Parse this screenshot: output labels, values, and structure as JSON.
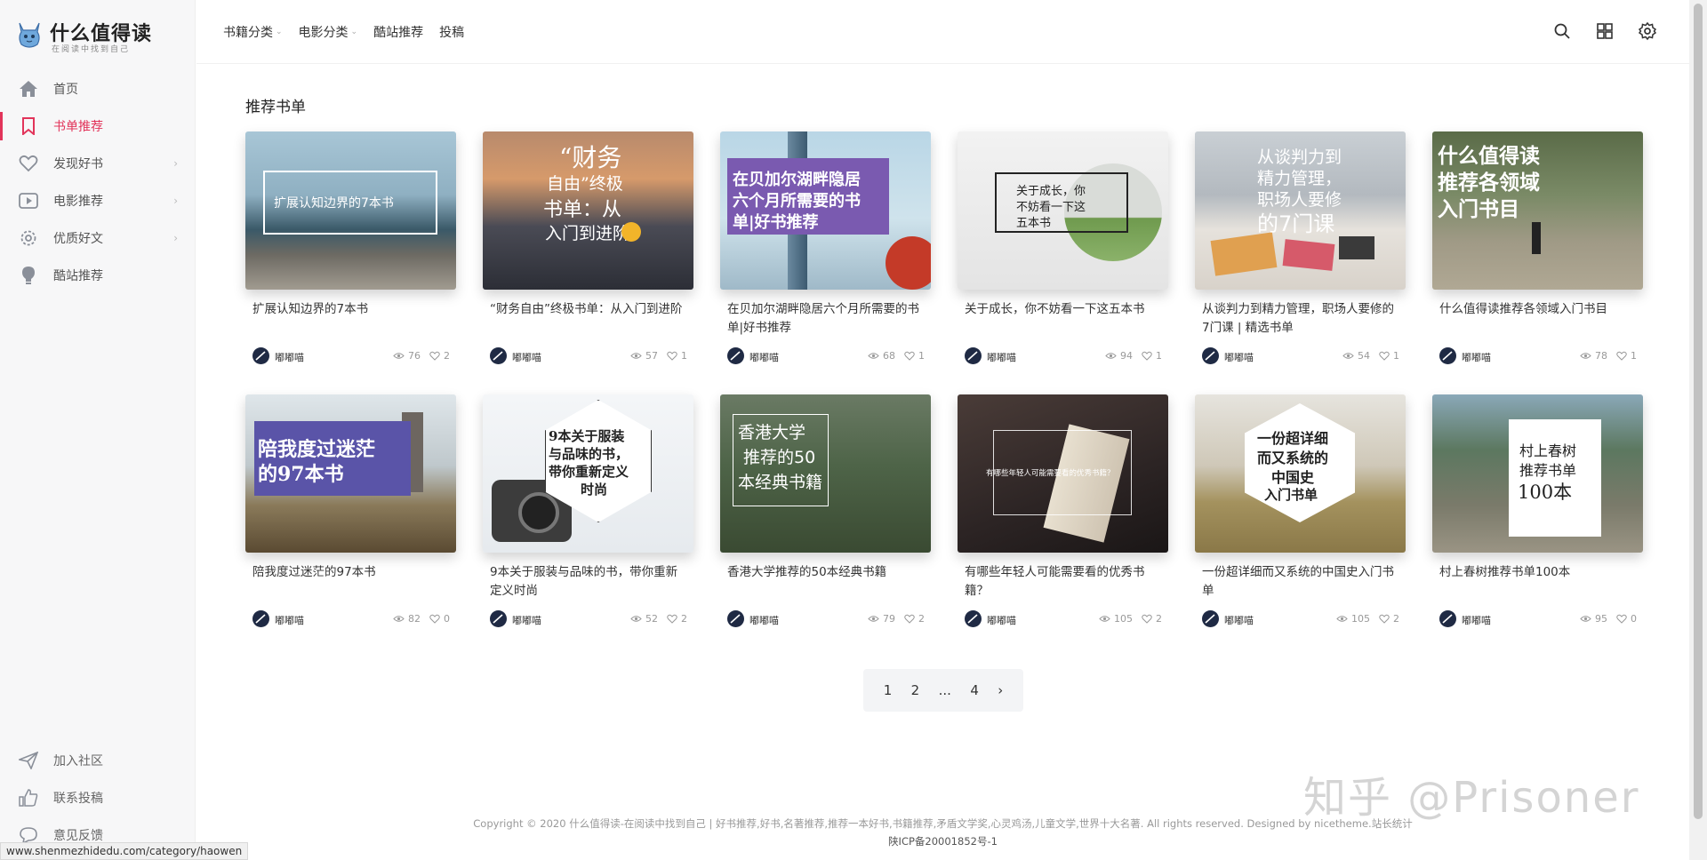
{
  "brand": {
    "title": "什么值得读",
    "subtitle": "在阅读中找到自己"
  },
  "sidebar": {
    "items": [
      {
        "label": "首页",
        "icon": "home-icon"
      },
      {
        "label": "书单推荐",
        "icon": "bookmark-icon",
        "active": true
      },
      {
        "label": "发现好书",
        "icon": "heart-icon",
        "chevron": "›"
      },
      {
        "label": "电影推荐",
        "icon": "video-icon",
        "chevron": "›"
      },
      {
        "label": "优质好文",
        "icon": "gear-icon",
        "chevron": "›"
      },
      {
        "label": "酷站推荐",
        "icon": "bulb-icon"
      }
    ],
    "bottom": [
      {
        "label": "加入社区",
        "icon": "paper-plane-icon"
      },
      {
        "label": "联系投稿",
        "icon": "thumbs-up-icon"
      },
      {
        "label": "意见反馈",
        "icon": "chat-icon"
      }
    ]
  },
  "header": {
    "nav": [
      {
        "label": "书籍分类",
        "caret": true
      },
      {
        "label": "电影分类",
        "caret": true
      },
      {
        "label": "酷站推荐"
      },
      {
        "label": "投稿"
      }
    ],
    "icons": [
      "search-icon",
      "grid-icon",
      "gear-icon"
    ]
  },
  "main": {
    "section_title": "推荐书单",
    "cards": [
      {
        "title": "扩展认知边界的7本书",
        "author": "嘟嘟喵",
        "views": "76",
        "likes": "2",
        "overlay": "扩展认知边界的7本书"
      },
      {
        "title": "“财务自由”终极书单：从入门到进阶",
        "author": "嘟嘟喵",
        "views": "57",
        "likes": "1",
        "overlay_lines": [
          "“财务",
          "自由”终极",
          "书单：从",
          "入门到进阶"
        ]
      },
      {
        "title": "在贝加尔湖畔隐居六个月所需要的书单|好书推荐",
        "author": "嘟嘟喵",
        "views": "68",
        "likes": "1",
        "overlay_lines": [
          "在贝加尔湖畔隐居",
          "六个月所需要的书",
          "单|好书推荐"
        ]
      },
      {
        "title": "关于成长，你不妨看一下这五本书",
        "author": "嘟嘟喵",
        "views": "94",
        "likes": "1",
        "overlay_lines": [
          "关于成长，你",
          "不妨看一下这",
          "五本书"
        ]
      },
      {
        "title": "从谈判力到精力管理，职场人要修的7门课 | 精选书单",
        "author": "嘟嘟喵",
        "views": "54",
        "likes": "1",
        "overlay_lines": [
          "从谈判力到",
          "精力管理，",
          "职场人要修",
          "的7门课"
        ]
      },
      {
        "title": "什么值得读推荐各领域入门书目",
        "author": "嘟嘟喵",
        "views": "78",
        "likes": "1",
        "overlay_lines": [
          "什么值得读",
          "推荐各领域",
          "入门书目"
        ]
      },
      {
        "title": "陪我度过迷茫的97本书",
        "author": "嘟嘟喵",
        "views": "82",
        "likes": "0",
        "overlay_lines": [
          "陪我度过迷茫",
          "的97本书"
        ]
      },
      {
        "title": "9本关于服装与品味的书，带你重新定义时尚",
        "author": "嘟嘟喵",
        "views": "52",
        "likes": "2",
        "overlay_lines": [
          "9本关于服装",
          "与品味的书，",
          "带你重新定义",
          "时尚"
        ]
      },
      {
        "title": "香港大学推荐的50本经典书籍",
        "author": "嘟嘟喵",
        "views": "79",
        "likes": "2",
        "overlay_lines": [
          "香港大学",
          "推荐的50",
          "本经典书籍"
        ]
      },
      {
        "title": "有哪些年轻人可能需要看的优秀书籍？",
        "author": "嘟嘟喵",
        "views": "105",
        "likes": "2",
        "overlay": "有哪些年轻人可能需要看的优秀书籍？"
      },
      {
        "title": "一份超详细而又系统的中国史入门书单",
        "author": "嘟嘟喵",
        "views": "105",
        "likes": "2",
        "overlay_lines": [
          "一份超详细",
          "而又系统的",
          "中国史",
          "入门书单"
        ]
      },
      {
        "title": "村上春树推荐书单100本",
        "author": "嘟嘟喵",
        "views": "95",
        "likes": "0",
        "overlay_lines": [
          "村上春树",
          "推荐书单",
          "100本"
        ]
      }
    ]
  },
  "pagination": {
    "pages": [
      "1",
      "2",
      "...",
      "4"
    ],
    "next": "›"
  },
  "footer": {
    "copyright": "Copyright © 2020 什么值得读-在阅读中找到自己 | 好书推荐,好书,名著推荐,推荐一本好书,书籍推荐,矛盾文学奖,心灵鸡汤,儿童文学,世界十大名著. All rights reserved. Designed by nicetheme.站长统计",
    "icp": "陕ICP备20001852号-1"
  },
  "watermark": "知乎 @Prisoner",
  "status_url": "www.shenmezhidedu.com/category/haowen",
  "colors": {
    "accent": "#e2345a",
    "sidebar_bg": "#f7f7f8"
  }
}
